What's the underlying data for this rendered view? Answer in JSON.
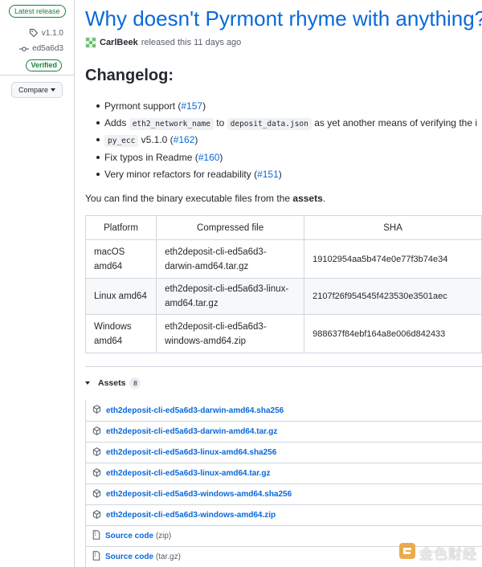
{
  "release": {
    "latest_label": "Latest release",
    "tag": "v1.1.0",
    "commit": "ed5a6d3",
    "verified": "Verified",
    "compare_label": "Compare",
    "title": "Why doesn't Pyrmont rhyme with anything?",
    "author": "CarlBeek",
    "released_text": "released this 11 days ago"
  },
  "changelog": {
    "heading": "Changelog:",
    "items": [
      {
        "text": "Pyrmont support (",
        "link": "#157",
        "after": ")"
      },
      {
        "pre": "Adds",
        "code1": "eth2_network_name",
        "mid": "to",
        "code2": "deposit_data.json",
        "post": "as yet another means of verifying the i"
      },
      {
        "code": "py_ecc",
        "text": " v5.1.0 (",
        "link": "#162",
        "after": ")"
      },
      {
        "text": "Fix typos in Readme (",
        "link": "#160",
        "after": ")"
      },
      {
        "text": "Very minor refactors for readability (",
        "link": "#151",
        "after": ")"
      }
    ],
    "note_pre": "You can find the binary executable files from the ",
    "note_bold": "assets",
    "note_post": "."
  },
  "files_table": {
    "headers": [
      "Platform",
      "Compressed file",
      "SHA"
    ],
    "rows": [
      {
        "platform": "macOS amd64",
        "file": "eth2deposit-cli-ed5a6d3-darwin-amd64.tar.gz",
        "sha": "19102954aa5b474e0e77f3b74e34"
      },
      {
        "platform": "Linux amd64",
        "file": "eth2deposit-cli-ed5a6d3-linux-amd64.tar.gz",
        "sha": "2107f26f954545f423530e3501aec"
      },
      {
        "platform": "Windows amd64",
        "file": "eth2deposit-cli-ed5a6d3-windows-amd64.zip",
        "sha": "988637f84ebf164a8e006d842433"
      }
    ]
  },
  "assets": {
    "label": "Assets",
    "count": "8",
    "files": [
      "eth2deposit-cli-ed5a6d3-darwin-amd64.sha256",
      "eth2deposit-cli-ed5a6d3-darwin-amd64.tar.gz",
      "eth2deposit-cli-ed5a6d3-linux-amd64.sha256",
      "eth2deposit-cli-ed5a6d3-linux-amd64.tar.gz",
      "eth2deposit-cli-ed5a6d3-windows-amd64.sha256",
      "eth2deposit-cli-ed5a6d3-windows-amd64.zip"
    ],
    "source": [
      {
        "label": "Source code",
        "format": "(zip)"
      },
      {
        "label": "Source code",
        "format": "(tar.gz)"
      }
    ]
  },
  "watermark": {
    "text": "金色财经"
  },
  "icons": {
    "tag": "tag-icon",
    "commit": "git-commit-icon",
    "package": "package-icon",
    "zip": "file-zip-icon",
    "triangle": "triangle-down-icon"
  },
  "colors": {
    "link": "#0969da",
    "success": "#1a7f37",
    "border": "#d0d7de",
    "watermark": "#e8a33a"
  }
}
